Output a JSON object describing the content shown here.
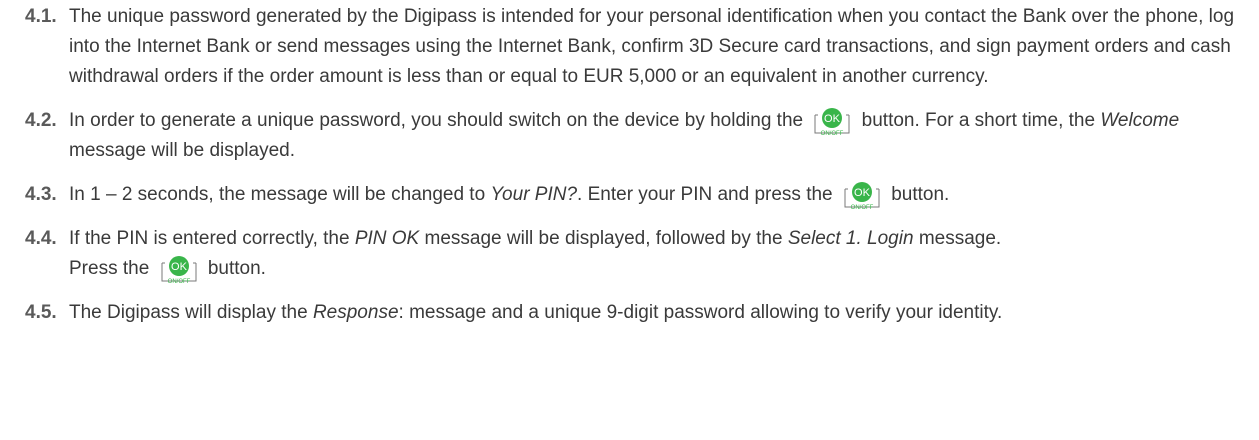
{
  "button_icon": {
    "circle_text": "OK",
    "under_text": "ON/OFF",
    "color": "#39b54a"
  },
  "items": [
    {
      "number": "4.1.",
      "text": "The unique password generated by the Digipass is intended for your personal identification when you contact the Bank over the phone, log into the Internet Bank or send messages using the Internet Bank, confirm 3D Secure card transactions, and sign payment orders and cash withdrawal orders if the order amount is less than or equal to EUR 5,000 or an equivalent in another currency."
    },
    {
      "number": "4.2.",
      "part1": "In order to generate a unique password, you should switch on the device by holding the",
      "part2": "button. For a short time, the",
      "italic1": "Welcome",
      "part3": "message will be displayed."
    },
    {
      "number": "4.3.",
      "part1": "In 1 – 2 seconds, the message will be changed to",
      "italic1": "Your PIN?",
      "part2": ". Enter your PIN and press the",
      "part3": "button."
    },
    {
      "number": "4.4.",
      "part1": "If the PIN is entered correctly, the",
      "italic1": "PIN OK",
      "part2": "message will be displayed, followed by the",
      "italic2": "Select 1. Login",
      "part3": "message.",
      "part4": "Press the",
      "part5": "button."
    },
    {
      "number": "4.5.",
      "part1": "The Digipass will display the",
      "italic1": "Response",
      "part2": ": message and a unique 9-digit password allowing to verify your identity."
    }
  ]
}
